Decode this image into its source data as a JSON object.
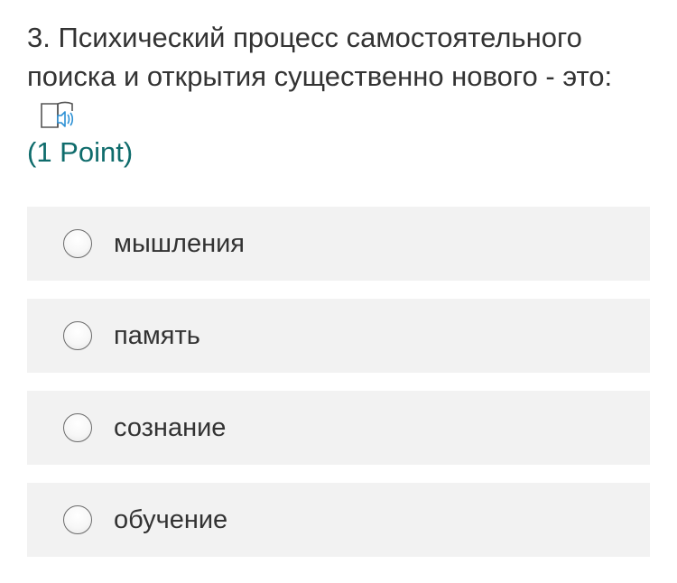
{
  "question": {
    "title": "3. Психический процесс самостоятельного поиска и открытия существенно нового - это:",
    "points": "(1 Point)",
    "reader_icon": "immersive-reader-icon"
  },
  "choices": [
    {
      "label": "мышления",
      "selected": false
    },
    {
      "label": "память",
      "selected": false
    },
    {
      "label": "сознание",
      "selected": false
    },
    {
      "label": "обучение",
      "selected": false
    }
  ],
  "colors": {
    "points": "#0f6c6c",
    "choice_background": "#f2f2f2",
    "text": "#333333",
    "icon_accent": "#2a8fd4"
  }
}
